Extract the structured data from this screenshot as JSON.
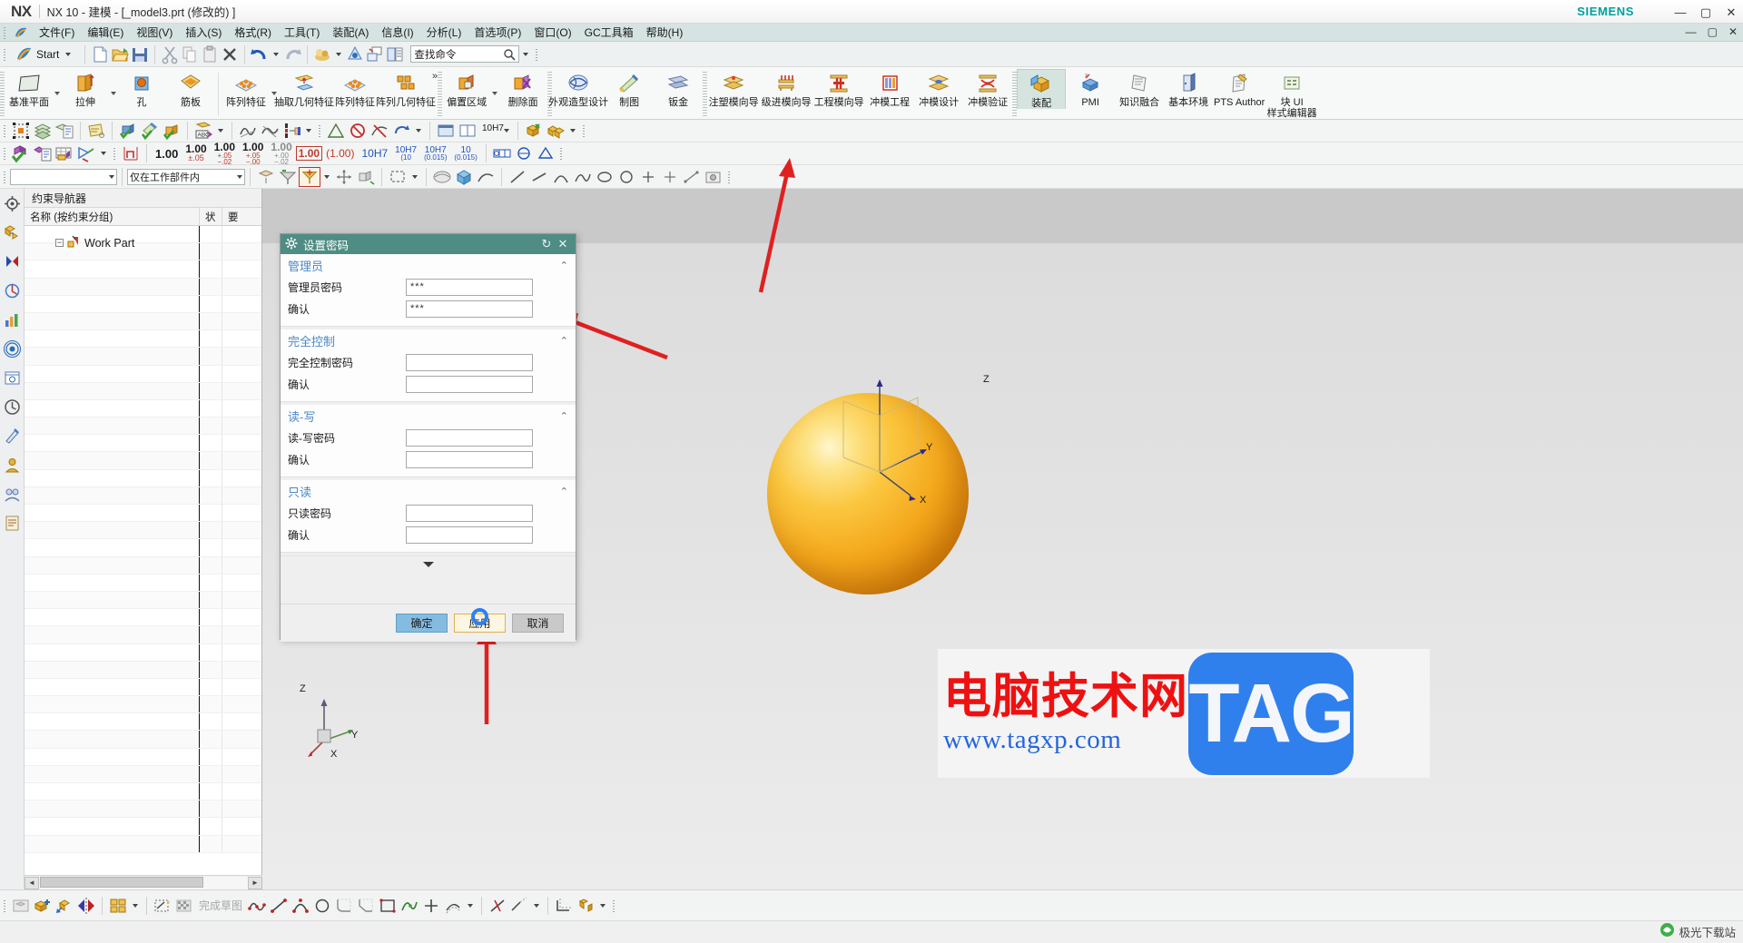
{
  "titlebar": {
    "logo": "NX",
    "title": "NX 10 - 建模 - [_model3.prt  (修改的)  ]",
    "brand": "SIEMENS",
    "buttons": {
      "minimize": "—",
      "maximize": "▢",
      "close": "✕"
    }
  },
  "menubar": {
    "items": [
      {
        "label": "文件(F)"
      },
      {
        "label": "编辑(E)"
      },
      {
        "label": "视图(V)"
      },
      {
        "label": "插入(S)"
      },
      {
        "label": "格式(R)"
      },
      {
        "label": "工具(T)"
      },
      {
        "label": "装配(A)"
      },
      {
        "label": "信息(I)"
      },
      {
        "label": "分析(L)"
      },
      {
        "label": "首选项(P)"
      },
      {
        "label": "窗口(O)"
      },
      {
        "label": "GC工具箱"
      },
      {
        "label": "帮助(H)"
      }
    ],
    "window_buttons": {
      "minimize": "—",
      "restore": "▢",
      "close": "✕"
    }
  },
  "quick_access": {
    "start_label": "Start",
    "find_placeholder": "查找命令",
    "icons": [
      "new-file-icon",
      "open-folder-icon",
      "save-icon",
      "cut-icon",
      "copy-icon",
      "paste-icon",
      "delete-icon",
      "undo-icon",
      "redo-icon",
      "render-style-icon",
      "shadow-icon",
      "window-icon",
      "layout-icon"
    ]
  },
  "ribbon": {
    "groups": [
      {
        "buttons": [
          {
            "label": "基准平面",
            "icon": "datum-plane-icon",
            "caret": true
          },
          {
            "label": "拉伸",
            "icon": "extrude-icon",
            "caret": true
          },
          {
            "label": "孔",
            "icon": "hole-icon",
            "caret": false
          },
          {
            "label": "筋板",
            "icon": "rib-icon",
            "caret": false
          }
        ]
      },
      {
        "buttons": [
          {
            "label": "阵列特征",
            "icon": "pattern-feature-icon",
            "caret": true
          },
          {
            "label": "抽取几何特征",
            "icon": "extract-geometry-icon",
            "caret": false
          },
          {
            "label": "阵列特征",
            "icon": "pattern-feature-icon",
            "caret": false
          },
          {
            "label": "阵列几何特征",
            "icon": "pattern-geometry-icon",
            "caret": false
          }
        ],
        "overflow": "»"
      },
      {
        "buttons": [
          {
            "label": "偏置区域",
            "icon": "offset-region-icon",
            "caret": true
          },
          {
            "label": "删除面",
            "icon": "delete-face-icon",
            "caret": false
          }
        ]
      },
      {
        "buttons": [
          {
            "label": "外观造型设计",
            "icon": "shape-studio-icon",
            "caret": false
          },
          {
            "label": "制图",
            "icon": "drafting-icon",
            "caret": false
          },
          {
            "label": "钣金",
            "icon": "sheet-metal-icon",
            "caret": false
          }
        ]
      },
      {
        "buttons": [
          {
            "label": "注塑模向导",
            "icon": "mold-wizard-icon",
            "caret": false
          },
          {
            "label": "级进模向导",
            "icon": "progressive-die-wizard-icon",
            "caret": false
          },
          {
            "label": "工程模向导",
            "icon": "die-engineering-wizard-icon",
            "caret": false
          },
          {
            "label": "冲模工程",
            "icon": "die-engineering-icon",
            "caret": false
          },
          {
            "label": "冲模设计",
            "icon": "die-design-icon",
            "caret": false
          },
          {
            "label": "冲模验证",
            "icon": "die-validation-icon",
            "caret": false
          }
        ]
      },
      {
        "buttons": [
          {
            "label": "装配",
            "icon": "assembly-icon",
            "caret": false,
            "active": true
          },
          {
            "label": "PMI",
            "icon": "pmi-icon",
            "caret": false
          },
          {
            "label": "知识融合",
            "icon": "knowledge-fusion-icon",
            "caret": false
          },
          {
            "label": "基本环境",
            "icon": "gateway-icon",
            "caret": false
          },
          {
            "label": "PTS Author",
            "icon": "pts-author-icon",
            "caret": false
          },
          {
            "label": "块 UI 样式编辑器",
            "icon": "block-ui-styler-icon",
            "caret": false
          }
        ]
      }
    ]
  },
  "toolbar_rows": {
    "row1_icons": [
      "select-all-icon",
      "layer-settings-icon",
      "layer-category-icon",
      "note-icon",
      "wcs-dynamics-icon",
      "wcs-orient-icon",
      "wcs-display-icon",
      "abc-text-icon",
      "surface-analysis-icon",
      "face-analysis-icon",
      "measure-icon"
    ],
    "row2_icons": [
      "check-assembly-icon",
      "assembly-report-icon",
      "assembly-table-icon",
      "orient-view-icon",
      "datum-axis-icon"
    ],
    "row2_tolerances": [
      {
        "text": "1.00",
        "style": "plain"
      },
      {
        "text": "1.00 ±.05",
        "style": "plain"
      },
      {
        "text": "1.00 +.05 -.02",
        "style": "plain"
      },
      {
        "text": "1.00 +.05 -.00",
        "style": "plain"
      },
      {
        "text": "1.00 +.00 -.02",
        "style": "grey"
      },
      {
        "text": "1.00",
        "style": "boxed-red"
      },
      {
        "text": "(1.00)",
        "style": "red"
      },
      {
        "text": "10H7",
        "style": "blue"
      },
      {
        "text": "10H7 (10)",
        "style": "blue"
      },
      {
        "text": "10H7 (0.015)",
        "style": "blue"
      },
      {
        "text": "10 (0.015)",
        "style": "blue"
      }
    ],
    "row3_combo_left": "",
    "row3_combo_right": "仅在工作部件内",
    "row3_icons": [
      "snap-point-icon",
      "snap-filter-icon",
      "wcs-move-icon",
      "selection-scope-icon",
      "face-select-icon",
      "body-select-icon",
      "curve-select-icon",
      "line-icon",
      "arc-icon",
      "spline-icon",
      "ellipse-icon",
      "circle-icon",
      "point-icon",
      "plus-icon",
      "measure-dist-icon",
      "snapshot-icon"
    ]
  },
  "left_rail": {
    "icons": [
      "assembly-navigator-icon",
      "constraint-navigator-icon",
      "part-navigator-icon",
      "reuse-library-icon",
      "history-analysis-icon",
      "hd3d-tools-icon",
      "web-browser-icon",
      "history-icon",
      "process-studio-icon",
      "role-icon",
      "system-scene-icon",
      "roles-panel-icon"
    ]
  },
  "navigator": {
    "title": "约束导航器",
    "columns": [
      {
        "label": "名称 (按约束分组)"
      },
      {
        "label": "状"
      },
      {
        "label": "要"
      }
    ],
    "tree": [
      {
        "label": "Work Part",
        "expander": "−",
        "icon": "work-part-icon"
      }
    ],
    "scrollbar": {
      "left_arrow": "◄",
      "right_arrow": "►"
    }
  },
  "graphics": {
    "model": {
      "name": "sphere-body",
      "color": "#f4a81c"
    },
    "csys_labels": {
      "z": "Z",
      "y": "Y",
      "x": "X"
    },
    "wcs_labels": {
      "z": "Z",
      "y": "Y",
      "x": "X"
    }
  },
  "watermark": {
    "chinese": "电脑技术网",
    "url": "www.tagxp.com",
    "tag": "TAG"
  },
  "dialog": {
    "title": "设置密码",
    "icon": "gear-icon",
    "title_buttons": {
      "reset": "↻",
      "close": "✕"
    },
    "sections": [
      {
        "title": "管理员",
        "collapse": "⌃",
        "fields": [
          {
            "label": "管理员密码",
            "value": "***"
          },
          {
            "label": "确认",
            "value": "***"
          }
        ]
      },
      {
        "title": "完全控制",
        "collapse": "⌃",
        "fields": [
          {
            "label": "完全控制密码",
            "value": ""
          },
          {
            "label": "确认",
            "value": ""
          }
        ]
      },
      {
        "title": "读-写",
        "collapse": "⌃",
        "fields": [
          {
            "label": "读-写密码",
            "value": ""
          },
          {
            "label": "确认",
            "value": ""
          }
        ]
      },
      {
        "title": "只读",
        "collapse": "⌃",
        "fields": [
          {
            "label": "只读密码",
            "value": ""
          },
          {
            "label": "确认",
            "value": ""
          }
        ]
      }
    ],
    "buttons": {
      "ok": "确定",
      "apply": "应用",
      "cancel": "取消"
    }
  },
  "bottom_toolbar": {
    "finish_sketch_label": "完成草图",
    "icons": [
      "show-hide-icon",
      "add-component-icon",
      "move-component-icon",
      "mirror-assembly-icon",
      "pattern-component-icon",
      "sketch-in-task-icon",
      "finish-sketch-icon",
      "profile-icon",
      "line-icon",
      "arc-icon",
      "circle-icon",
      "fillet-icon",
      "chamfer-icon",
      "rectangle-icon",
      "studio-spline-icon",
      "point-icon",
      "offset-curve-icon",
      "trim-curve-icon",
      "quick-trim-icon",
      "quick-extend-icon",
      "make-corner-icon",
      "constraints-icon"
    ]
  },
  "status_bar": {
    "badge_text": "极光下载站",
    "badge_icon": "aurora-icon"
  },
  "annotations": {
    "arrows": [
      {
        "name": "arrow-to-assembly-toolbar",
        "color": "#e02020"
      },
      {
        "name": "arrow-to-admin-confirm-field",
        "color": "#e02020"
      },
      {
        "name": "arrow-to-apply-button",
        "color": "#e02020"
      }
    ],
    "click_ring_color": "#2f80ed"
  },
  "colors": {
    "dialog_title_bg": "#4f8d84",
    "section_title": "#4a88c7",
    "ribbon_active": "#d5e4de",
    "menubar_bg": "#d6e3e3",
    "apply_highlight": "#e0b050",
    "siemens_teal": "#00a0a0"
  }
}
